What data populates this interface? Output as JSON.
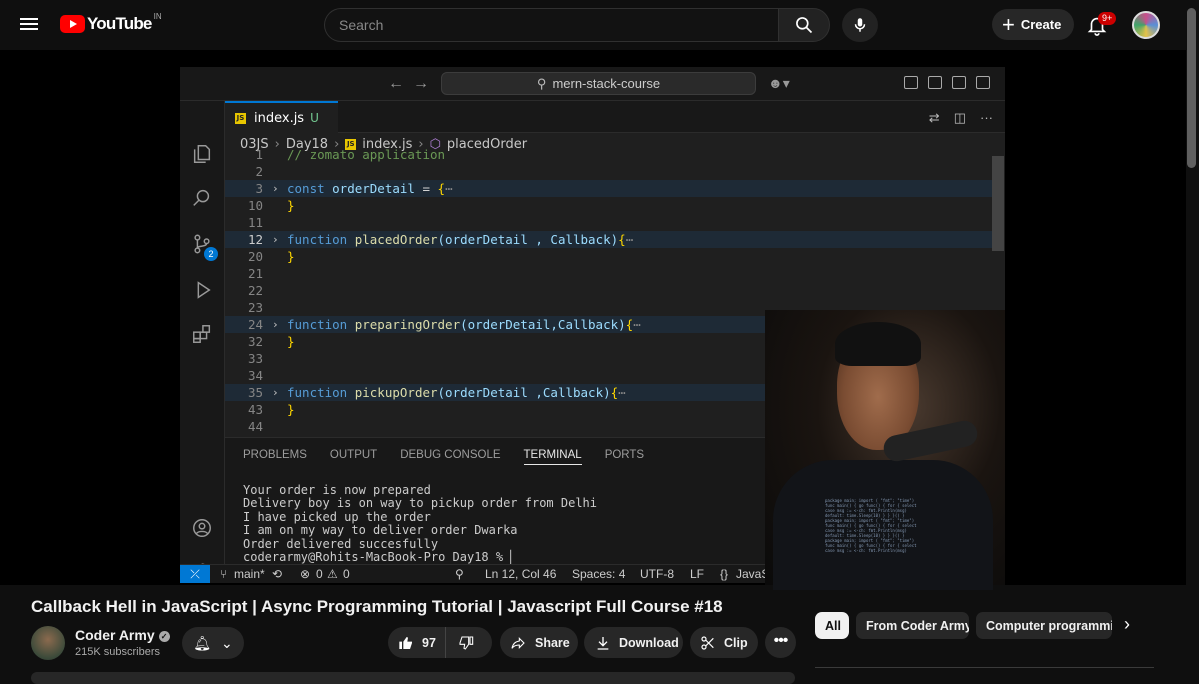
{
  "header": {
    "logo_text": "YouTube",
    "country_code": "IN",
    "search_placeholder": "Search",
    "create_label": "Create",
    "notification_badge": "9+"
  },
  "vscode": {
    "command_center": "mern-stack-course",
    "tab": {
      "badge": "JS",
      "label": "index.js",
      "status": "U"
    },
    "breadcrumb": [
      "03JS",
      "Day18",
      "index.js",
      "placedOrder"
    ],
    "activity_badge": "2",
    "code_lines": [
      {
        "n": "1",
        "fold": "",
        "html_kind": "comment",
        "text": "// zomato application"
      },
      {
        "n": "2",
        "fold": "",
        "text": ""
      },
      {
        "n": "3",
        "fold": ">",
        "hl": true,
        "kw": "const",
        "name": "orderDetail",
        "rest": " = ",
        "brace": "{",
        "ell": "⋯"
      },
      {
        "n": "10",
        "fold": "",
        "brace_close": "}"
      },
      {
        "n": "11",
        "fold": "",
        "text": ""
      },
      {
        "n": "12",
        "fold": ">",
        "hl": true,
        "active": true,
        "kw": "function",
        "fname": "placedOrder",
        "params": "(orderDetail , Callback)",
        "brace": "{",
        "ell": "⋯"
      },
      {
        "n": "20",
        "fold": "",
        "brace_close": "}"
      },
      {
        "n": "21",
        "fold": "",
        "text": ""
      },
      {
        "n": "22",
        "fold": "",
        "text": ""
      },
      {
        "n": "23",
        "fold": "",
        "text": ""
      },
      {
        "n": "24",
        "fold": ">",
        "hl": true,
        "kw": "function",
        "fname": "preparingOrder",
        "params": "(orderDetail,Callback)",
        "brace": "{",
        "ell": "⋯"
      },
      {
        "n": "32",
        "fold": "",
        "brace_close": "}"
      },
      {
        "n": "33",
        "fold": "",
        "text": ""
      },
      {
        "n": "34",
        "fold": "",
        "text": ""
      },
      {
        "n": "35",
        "fold": ">",
        "hl": true,
        "kw": "function",
        "fname": "pickupOrder",
        "params": "(orderDetail ,Callback)",
        "brace": "{",
        "ell": "⋯"
      },
      {
        "n": "43",
        "fold": "",
        "brace_close": "}"
      },
      {
        "n": "44",
        "fold": "",
        "text": ""
      }
    ],
    "panel_tabs": [
      "PROBLEMS",
      "OUTPUT",
      "DEBUG CONSOLE",
      "TERMINAL",
      "PORTS"
    ],
    "panel_active": "TERMINAL",
    "terminal_lines": [
      "Your order is now prepared",
      "Delivery boy is on way to pickup order from Delhi",
      "I have picked up the order",
      "I am on my way to deliver order Dwarka",
      "Order delivered succesfully",
      "coderarmy@Rohits-MacBook-Pro Day18 % ▏"
    ],
    "status": {
      "branch": "main*",
      "errors": "0",
      "warnings": "0",
      "cursor": "Ln 12, Col 46",
      "spaces": "Spaces: 4",
      "encoding": "UTF-8",
      "eol": "LF",
      "language": "JavaS"
    }
  },
  "video": {
    "title": "Callback Hell in JavaScript | Async Programming Tutorial | Javascript Full Course #18",
    "channel": "Coder Army",
    "subscribers": "215K subscribers",
    "likes": "97",
    "share_label": "Share",
    "download_label": "Download",
    "clip_label": "Clip"
  },
  "chips": [
    "All",
    "From Coder Army",
    "Computer programming"
  ],
  "colors": {
    "accent_red": "#ff0000",
    "vscode_blue": "#0078d4",
    "background": "#0f0f0f"
  }
}
